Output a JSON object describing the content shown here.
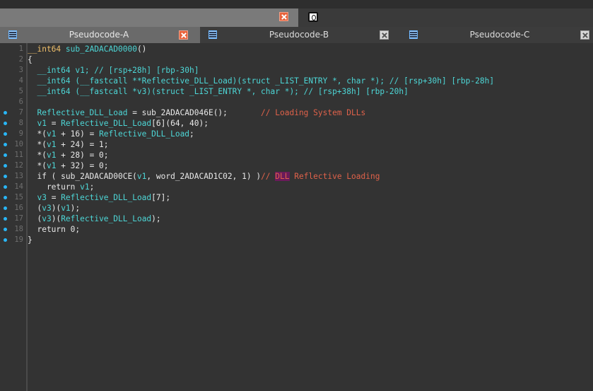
{
  "window": {
    "top_close_icon": "close-icon",
    "top_tab_icon": "clock-icon"
  },
  "tabs": [
    {
      "label": "Pseudocode-A",
      "active": true,
      "icon": "pseudocode-icon",
      "close_icon": "close-icon"
    },
    {
      "label": "Pseudocode-B",
      "active": false,
      "icon": "pseudocode-icon",
      "close_icon": "close-icon"
    },
    {
      "label": "Pseudocode-C",
      "active": false,
      "icon": "pseudocode-icon",
      "close_icon": "close-icon"
    }
  ],
  "code": {
    "line_numbers": [
      "1",
      "2",
      "3",
      "4",
      "5",
      "6",
      "7",
      "8",
      "9",
      "10",
      "11",
      "12",
      "13",
      "14",
      "15",
      "16",
      "17",
      "18",
      "19"
    ],
    "breakpoint_lines": [
      "7",
      "8",
      "9",
      "10",
      "11",
      "12",
      "13",
      "14",
      "15",
      "16",
      "17",
      "18",
      "19"
    ],
    "lines": [
      [
        {
          "cls": "kw",
          "text": "__int64"
        },
        {
          "cls": "t",
          "text": " sub_2ADACAD0000"
        },
        {
          "cls": "w",
          "text": "()"
        }
      ],
      [
        {
          "cls": "w",
          "text": "{"
        }
      ],
      [
        {
          "cls": "t",
          "text": "  __int64 v1; // [rsp+28h] [rbp-30h]"
        }
      ],
      [
        {
          "cls": "t",
          "text": "  __int64 (__fastcall **Reflective_DLL_Load)(struct _LIST_ENTRY *, char *); // [rsp+30h] [rbp-28h]"
        }
      ],
      [
        {
          "cls": "t",
          "text": "  __int64 (__fastcall *v3)(struct _LIST_ENTRY *, char *); // [rsp+38h] [rbp-20h]"
        }
      ],
      [
        {
          "cls": "w",
          "text": ""
        }
      ],
      [
        {
          "cls": "t",
          "text": "  Reflective_DLL_Load"
        },
        {
          "cls": "w",
          "text": " = sub_2ADACAD046E();"
        },
        {
          "cls": "c",
          "text": "       // Loading System DLLs"
        }
      ],
      [
        {
          "cls": "t",
          "text": "  v1"
        },
        {
          "cls": "w",
          "text": " = "
        },
        {
          "cls": "t",
          "text": "Reflective_DLL_Load"
        },
        {
          "cls": "w",
          "text": "[6](64, 40);"
        }
      ],
      [
        {
          "cls": "w",
          "text": "  *("
        },
        {
          "cls": "t",
          "text": "v1"
        },
        {
          "cls": "w",
          "text": " + 16) = "
        },
        {
          "cls": "t",
          "text": "Reflective_DLL_Load"
        },
        {
          "cls": "w",
          "text": ";"
        }
      ],
      [
        {
          "cls": "w",
          "text": "  *("
        },
        {
          "cls": "t",
          "text": "v1"
        },
        {
          "cls": "w",
          "text": " + 24) = 1;"
        }
      ],
      [
        {
          "cls": "w",
          "text": "  *("
        },
        {
          "cls": "t",
          "text": "v1"
        },
        {
          "cls": "w",
          "text": " + 28) = 0;"
        }
      ],
      [
        {
          "cls": "w",
          "text": "  *("
        },
        {
          "cls": "t",
          "text": "v1"
        },
        {
          "cls": "w",
          "text": " + 32) = 0;"
        }
      ],
      [
        {
          "cls": "w",
          "text": "  if ( sub_2ADACAD00CE("
        },
        {
          "cls": "t",
          "text": "v1"
        },
        {
          "cls": "w",
          "text": ", word_2ADACAD1C02, 1) )"
        },
        {
          "cls": "c",
          "text": "// "
        },
        {
          "cls": "hl",
          "text": "DLL"
        },
        {
          "cls": "c",
          "text": " Reflective Loading"
        }
      ],
      [
        {
          "cls": "w",
          "text": "    return "
        },
        {
          "cls": "t",
          "text": "v1"
        },
        {
          "cls": "w",
          "text": ";"
        }
      ],
      [
        {
          "cls": "t",
          "text": "  v3"
        },
        {
          "cls": "w",
          "text": " = "
        },
        {
          "cls": "t",
          "text": "Reflective_DLL_Load"
        },
        {
          "cls": "w",
          "text": "[7];"
        }
      ],
      [
        {
          "cls": "w",
          "text": "  ("
        },
        {
          "cls": "t",
          "text": "v3"
        },
        {
          "cls": "w",
          "text": ")("
        },
        {
          "cls": "t",
          "text": "v1"
        },
        {
          "cls": "w",
          "text": ");"
        }
      ],
      [
        {
          "cls": "w",
          "text": "  ("
        },
        {
          "cls": "t",
          "text": "v3"
        },
        {
          "cls": "w",
          "text": ")("
        },
        {
          "cls": "t",
          "text": "Reflective_DLL_Load"
        },
        {
          "cls": "w",
          "text": ");"
        }
      ],
      [
        {
          "cls": "w",
          "text": "  return 0;"
        }
      ],
      [
        {
          "cls": "w",
          "text": "}"
        }
      ]
    ]
  }
}
